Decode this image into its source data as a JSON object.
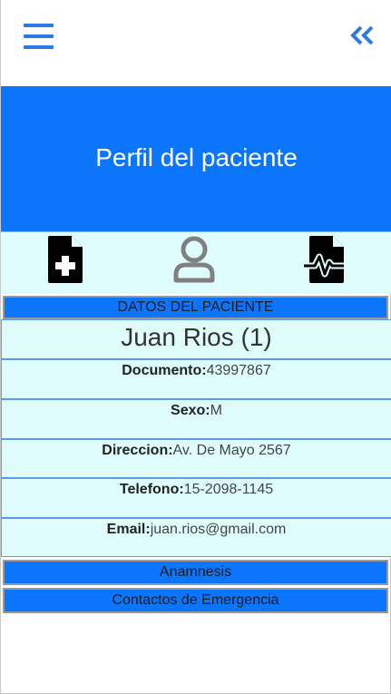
{
  "header": {
    "menu_icon": "hamburger-menu-icon",
    "back_icon": "double-chevron-left-icon"
  },
  "hero": {
    "title": "Perfil del paciente"
  },
  "iconbar": {
    "icons": [
      "file-medical-icon",
      "user-icon",
      "file-waveform-icon"
    ]
  },
  "patient_section": {
    "header": "DATOS DEL PACIENTE",
    "name": "Juan Rios (1)",
    "fields": [
      {
        "label": "Documento:",
        "value": "43997867"
      },
      {
        "label": "Sexo:",
        "value": "M"
      },
      {
        "label": "Direccion:",
        "value": "Av. De Mayo 2567"
      },
      {
        "label": "Telefono:",
        "value": "15-2098-1145"
      },
      {
        "label": "Email:",
        "value": "juan.rios@gmail.com"
      }
    ]
  },
  "sections": {
    "anamnesis": "Anamnesis",
    "emergency_contacts": "Contactos de Emergencia"
  },
  "colors": {
    "primary": "#0b75fb",
    "card_bg": "#dffdfd",
    "icon_blue": "#2d7be0"
  }
}
